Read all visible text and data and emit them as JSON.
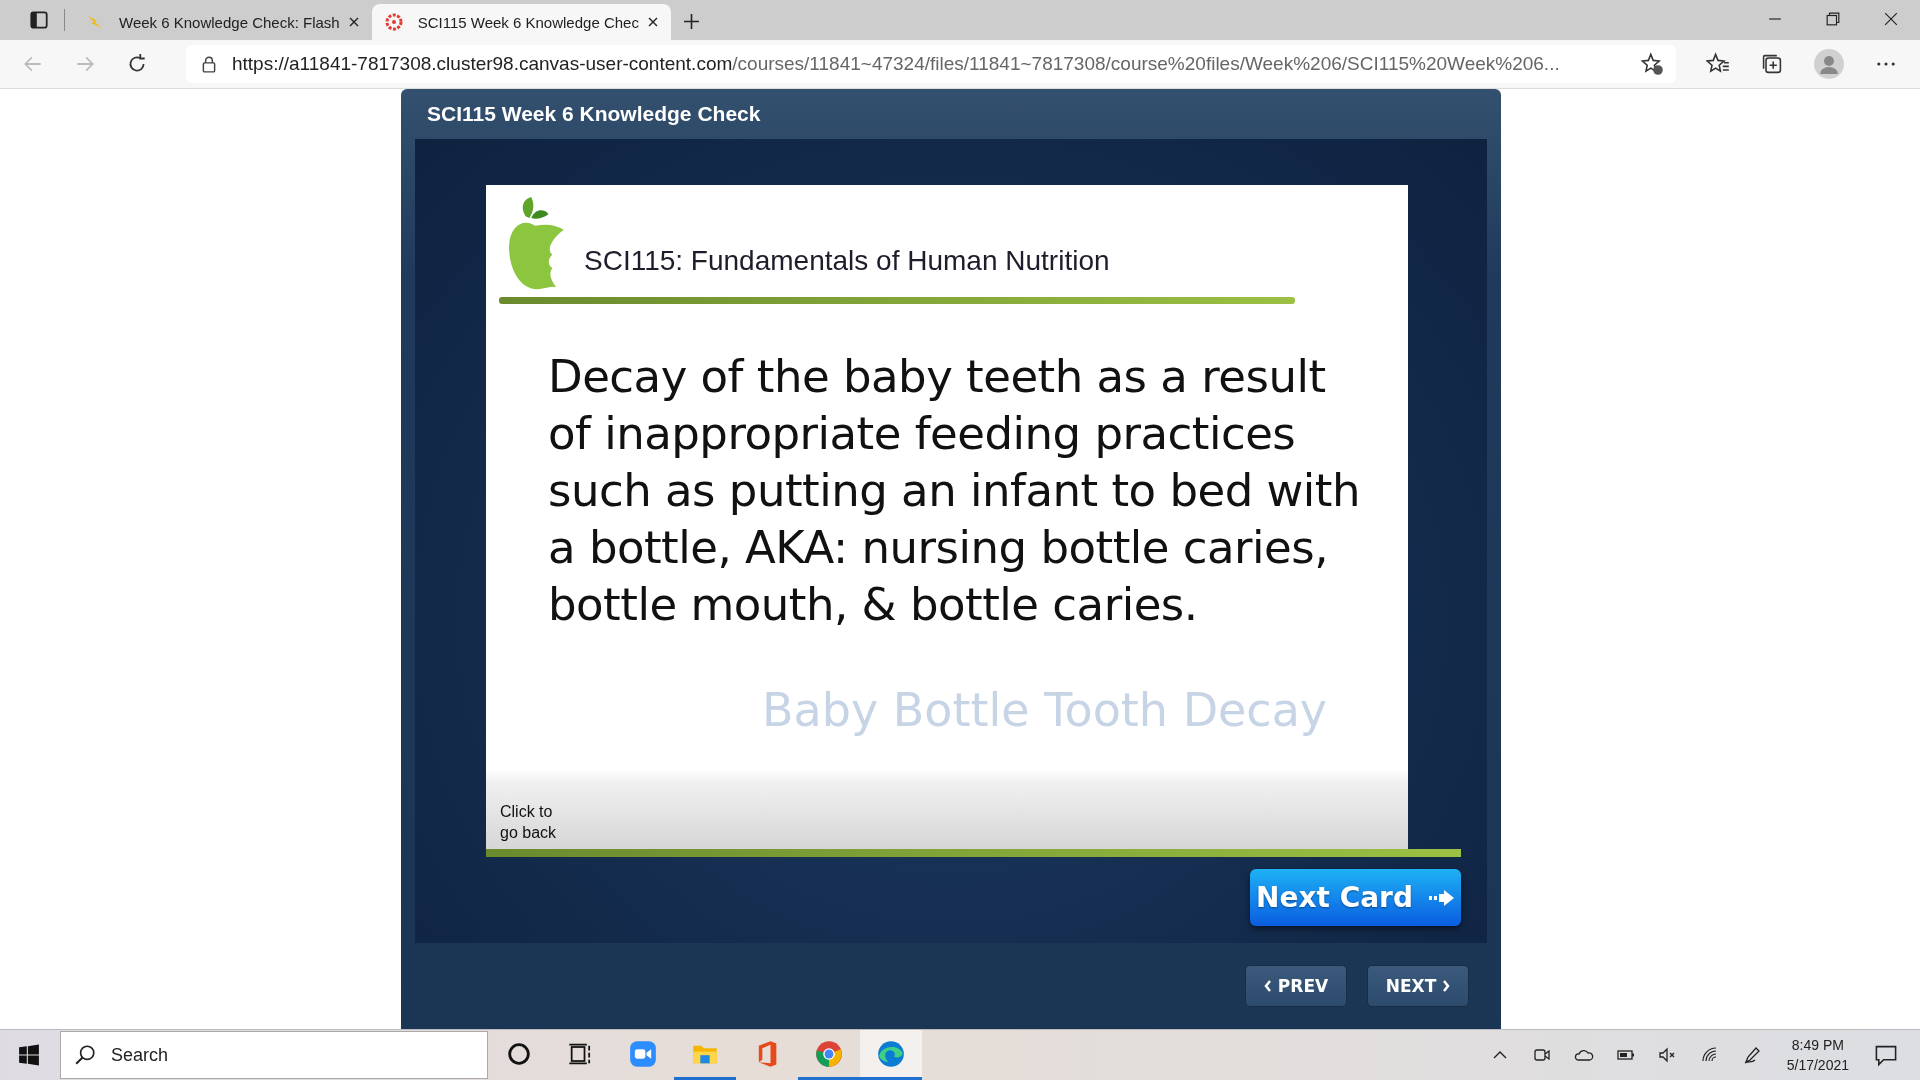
{
  "browser": {
    "tabs": [
      {
        "title": "Week 6 Knowledge Check: Flash",
        "selected": false,
        "kind": "flash"
      },
      {
        "title": "SCI115 Week 6 Knowledge Chec",
        "selected": true,
        "kind": "canvas"
      }
    ],
    "url_host": "https://a11841-7817308.cluster98.canvas-user-content.com",
    "url_path": "/courses/11841~47324/files/11841~7817308/course%20files/Week%206/SCI115%20Week%206..."
  },
  "player": {
    "title": "SCI115 Week 6 Knowledge Check",
    "card": {
      "course_title": "SCI115: Fundamentals of Human Nutrition",
      "question": "Decay of the baby teeth as a result of inappropriate feeding practices such as putting an infant to bed with a bottle, AKA: nursing bottle caries, bottle mouth, & bottle caries.",
      "answer": "Baby Bottle Tooth Decay",
      "back_link": "Click to go back"
    },
    "next_card": "Next Card",
    "prev": "PREV",
    "next": "NEXT"
  },
  "taskbar": {
    "search_placeholder": "Search",
    "apps": [
      {
        "kind": "cortana",
        "running": false,
        "selected": false
      },
      {
        "kind": "taskview",
        "running": false,
        "selected": false
      },
      {
        "kind": "zoom",
        "running": false,
        "selected": false
      },
      {
        "kind": "explorer",
        "running": true,
        "selected": false
      },
      {
        "kind": "office",
        "running": false,
        "selected": false
      },
      {
        "kind": "chrome",
        "running": true,
        "selected": false
      },
      {
        "kind": "edge",
        "running": true,
        "selected": true
      }
    ],
    "time": "8:49 PM",
    "date": "5/17/2021"
  }
}
